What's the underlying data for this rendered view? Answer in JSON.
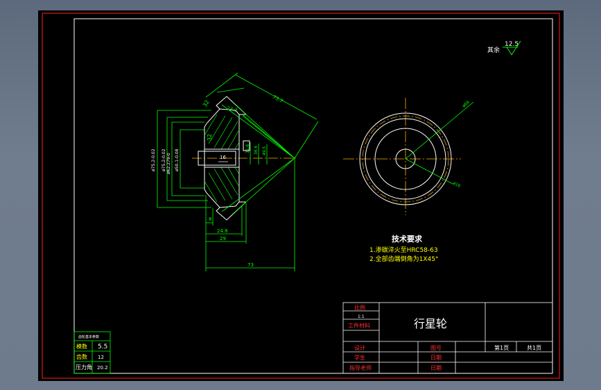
{
  "colors": {
    "background": "#000000",
    "frame": "#ff2020",
    "border": "#ffffff",
    "outline": "#00ff00",
    "text": "#ffffff",
    "dimension": "#00ff00",
    "dimension_text": "#00ff00",
    "centerline": "#ffb000",
    "table_text": "#ff3030"
  },
  "roughness": {
    "label": "其余",
    "value": "12.5"
  },
  "tech_requirements": {
    "title": "技术要求",
    "items": [
      "1.渗碳淬火至HRC58-63",
      "2.全部齿端倒角为1X45°"
    ]
  },
  "dimensions": {
    "top_slant": "73.7",
    "d1": "24.2",
    "d2": "32",
    "d3": "32",
    "phi1": "ø75.2-0.02",
    "phi2": "ø75.2-0.02",
    "phi3": "ø62.279-0",
    "phi4": "ø50.1-0.08",
    "r1": "31.6",
    "r2": "36.6",
    "r3": "49.5",
    "hole": "16",
    "b1": "8",
    "b2": "24.8",
    "b3": "29",
    "total": "73",
    "circle_large": "ø66",
    "circle_small": "ø16"
  },
  "gear_table": {
    "title": "齿轮基本参数",
    "rows": [
      {
        "label": "模数",
        "value": "5.5"
      },
      {
        "label": "齿数",
        "value": "12"
      },
      {
        "label": "压力角",
        "value": "20.2"
      }
    ]
  },
  "title_block": {
    "part_name": "行星轮",
    "scale_label": "比例",
    "scale_value": "1:1",
    "material_label": "工件材料",
    "designer_label": "设计",
    "drawing_no_label": "图号",
    "student_label": "学生",
    "date_label1": "日期",
    "teacher_label": "指导老师",
    "date_label2": "日期",
    "sheet_label": "第1页",
    "total_label": "共1页"
  }
}
